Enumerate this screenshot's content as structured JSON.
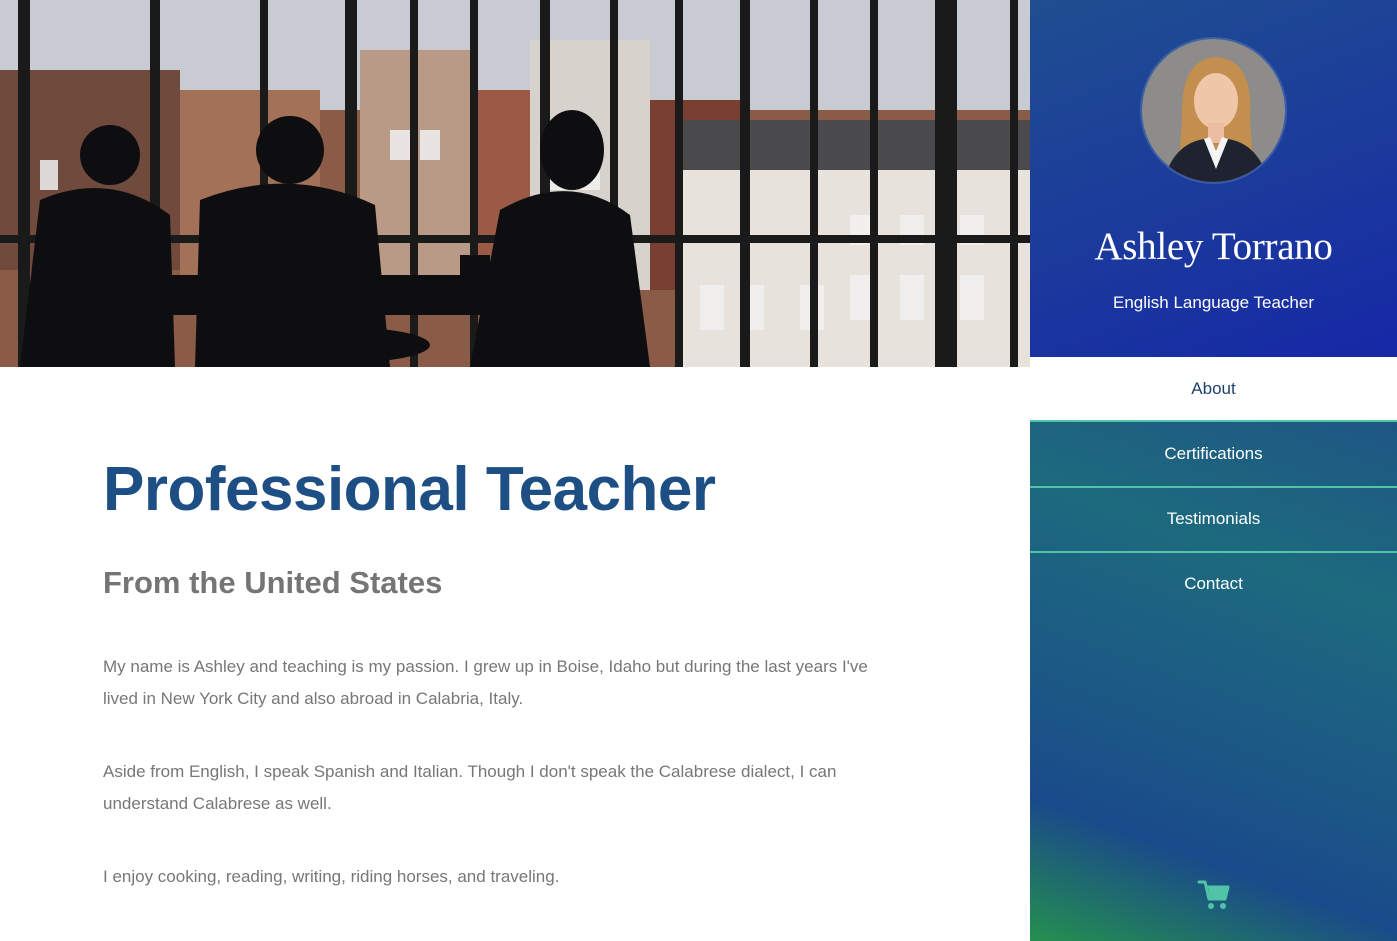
{
  "hero": {
    "image": "silhouettes-at-window-photo"
  },
  "main": {
    "title": "Professional Teacher",
    "subtitle": "From the United States",
    "paragraphs": [
      "My name is Ashley and teaching is my passion. I grew up in Boise, Idaho but during the last years I've lived in New York City and also abroad in Calabria, Italy.",
      "Aside from English, I speak Spanish and Italian. Though I don't speak the Calabrese dialect, I can understand Calabrese as well.",
      "I enjoy cooking, reading, writing, riding horses, and traveling."
    ]
  },
  "sidebar": {
    "name": "Ashley Torrano",
    "role": "English Language Teacher",
    "avatar": "profile-photo",
    "nav": [
      {
        "label": "About",
        "active": true
      },
      {
        "label": "Certifications",
        "active": false
      },
      {
        "label": "Testimonials",
        "active": false
      },
      {
        "label": "Contact",
        "active": false
      }
    ],
    "cart_icon": "shopping-cart-icon"
  },
  "colors": {
    "title": "#1d4e84",
    "subtitle": "#757575",
    "body_text": "#777777",
    "sidebar_top": "#1b3a9c",
    "sidebar_bottom_accent": "#24904f",
    "divider": "#4fc4a6",
    "cart": "#4fc4a6"
  }
}
